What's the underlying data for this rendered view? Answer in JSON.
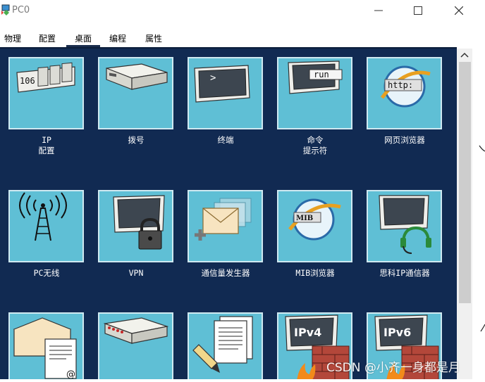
{
  "window": {
    "title": "PC0",
    "icon": "pc-app-icon",
    "controls": [
      "minimize-icon",
      "maximize-icon",
      "close-icon"
    ]
  },
  "tabs": [
    "物理",
    "配置",
    "桌面",
    "编程",
    "属性"
  ],
  "active_tab": "桌面",
  "desktop": {
    "background": "#112a52",
    "tile_color": "#5fbfd5",
    "apps": [
      {
        "label": "IP\n配置",
        "icon": "ip-config-icon"
      },
      {
        "label": "拨号",
        "icon": "dialup-modem-icon"
      },
      {
        "label": "终端",
        "icon": "terminal-icon"
      },
      {
        "label": "命令\n提示符",
        "icon": "command-prompt-icon",
        "icon_text": "run"
      },
      {
        "label": "网页浏览器",
        "icon": "web-browser-icon",
        "icon_text": "http:"
      },
      {
        "label": "PC无线",
        "icon": "wireless-tower-icon"
      },
      {
        "label": "VPN",
        "icon": "vpn-lock-icon"
      },
      {
        "label": "通信量发生器",
        "icon": "traffic-generator-icon"
      },
      {
        "label": "MIB浏览器",
        "icon": "mib-browser-icon",
        "icon_text": "MIB"
      },
      {
        "label": "思科IP通信器",
        "icon": "ip-communicator-icon"
      },
      {
        "label": "",
        "icon": "email-icon"
      },
      {
        "label": "",
        "icon": "pppoe-dialer-icon"
      },
      {
        "label": "",
        "icon": "text-editor-icon"
      },
      {
        "label": "",
        "icon": "ipv4-firewall-icon",
        "icon_text": "IPv4"
      },
      {
        "label": "",
        "icon": "ipv6-firewall-icon",
        "icon_text": "IPv6"
      }
    ]
  },
  "ip_icon_text": "106",
  "terminal_prompt": ">",
  "watermark": "CSDN @小齐一身都是月"
}
